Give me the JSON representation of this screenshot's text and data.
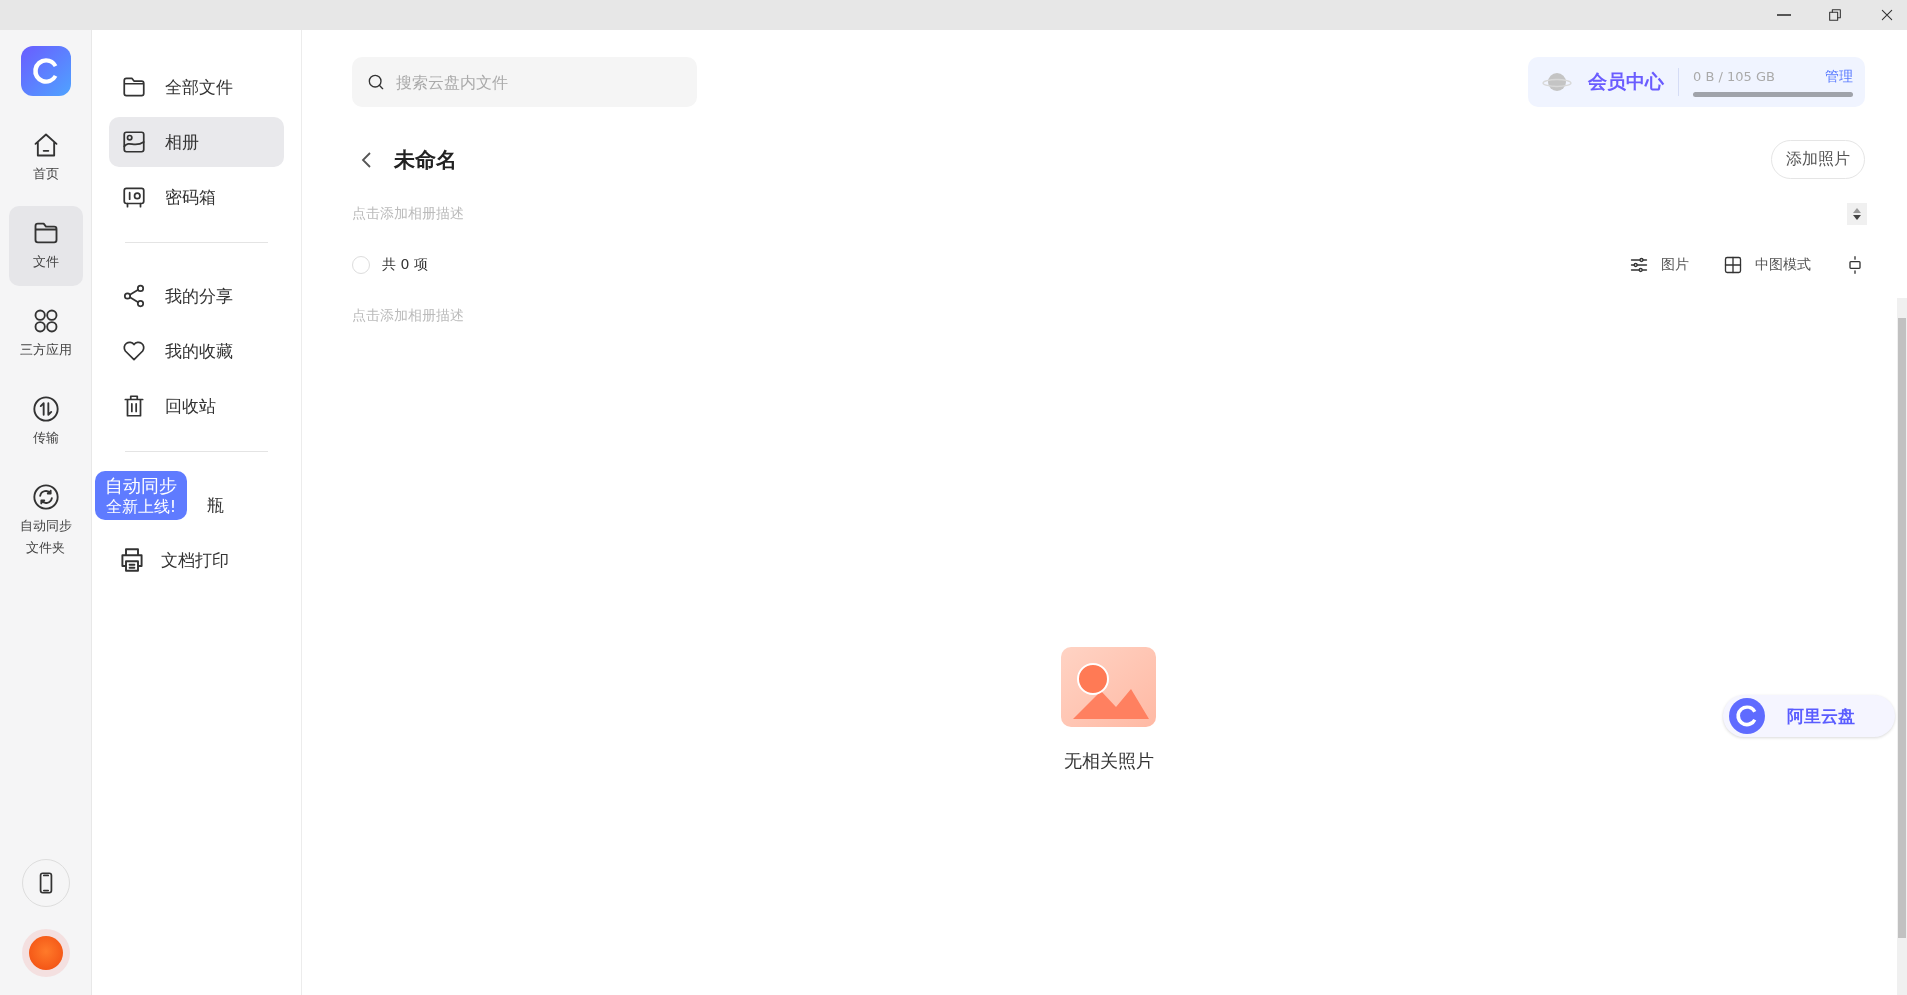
{
  "rail": {
    "items": [
      {
        "label": "首页",
        "selected": false
      },
      {
        "label": "文件",
        "selected": true
      },
      {
        "label": "三方应用",
        "selected": false
      },
      {
        "label": "传输",
        "selected": false
      },
      {
        "label": "自动同步文件夹",
        "selected": false
      }
    ]
  },
  "tooltip": {
    "title": "自动同步",
    "subtitle": "全新上线!"
  },
  "sidebar": {
    "groups": [
      [
        {
          "label": "全部文件",
          "selected": false
        },
        {
          "label": "相册",
          "selected": true
        },
        {
          "label": "密码箱",
          "selected": false
        }
      ],
      [
        {
          "label": "我的分享",
          "selected": false
        },
        {
          "label": "我的收藏",
          "selected": false
        },
        {
          "label": "回收站",
          "selected": false
        }
      ],
      [
        {
          "label": "瓶",
          "selected": false
        },
        {
          "label": "文档打印",
          "selected": false
        }
      ]
    ]
  },
  "search": {
    "placeholder": "搜索云盘内文件"
  },
  "member": {
    "title": "会员中心",
    "storage": "0 B / 105 GB",
    "level": 0,
    "manage": "管理"
  },
  "album": {
    "title": "未命名",
    "add_button": "添加照片",
    "description": "点击添加相册描述",
    "count": "共 0 项",
    "select_all_checked": false,
    "filter": "图片",
    "view_mode": "中图模式",
    "description_2": "点击添加相册描述"
  },
  "empty": {
    "message": "无相关照片"
  },
  "floating_badge": {
    "label": "阿里云盘"
  }
}
